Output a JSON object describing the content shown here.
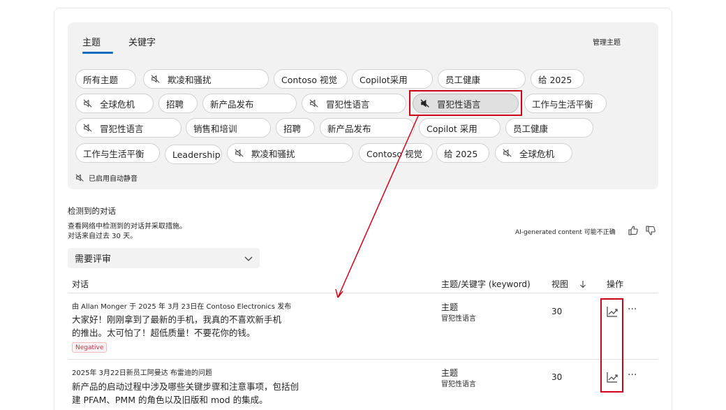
{
  "tabs": [
    {
      "label": "主题"
    },
    {
      "label": "关键字"
    }
  ],
  "manage_topics": "管理主题",
  "chips": {
    "row1": [
      "所有主题",
      "欺凌和骚扰",
      "Contoso 视觉",
      "Copilot采用",
      "员工健康",
      "给 2025"
    ],
    "row2": [
      "全球危机",
      "招聘",
      "新产品发布",
      "冒犯性语言",
      "冒犯性语言",
      "工作与生活平衡"
    ],
    "row3": [
      "冒犯性语言",
      "销售和培训",
      "招聘",
      "新产品发布",
      "Copilot 采用",
      "员工健康"
    ],
    "row4": [
      "工作与生活平衡",
      "Leadership",
      "欺凌和骚扰",
      "Contoso 视觉",
      "给 2025",
      "全球危机"
    ]
  },
  "auto_mute_label": "已启用自动静音",
  "section": {
    "title": "检测到的对话",
    "sub1": "查看网络中检测到的对话并采取措施。",
    "sub2": "对话来自过去 30 天。"
  },
  "ai_note": "AI-generated content 可能不正确",
  "filter": {
    "selected": "需要评审"
  },
  "table": {
    "headers": {
      "conversation": "对话",
      "topic": "主题/关键字 (keyword)",
      "views": "视图",
      "actions": "操作"
    },
    "rows": [
      {
        "meta": "由 Allan Monger 于 2025 年 3月 23日在 Contoso Electronics 发布",
        "line1": "大家好！刚刚拿到了最新的手机，我真的不喜欢新手机",
        "line2": "的推出。太可怕了！超低质量！不要花你的钱。",
        "badge": "Negative",
        "topic_label": "主题",
        "topic_value": "冒犯性语言",
        "views": "30"
      },
      {
        "meta": "2025年 3月22日新员工阿曼达 布雷迪的问题",
        "line1": "新产品的启动过程中涉及哪些关键步骤和注意事项，包括创",
        "line2": "建 PFAM、PMM 的角色以及旧版和 mod 的集成。",
        "topic_label": "主题",
        "topic_value": "冒犯性语言",
        "views": "30"
      }
    ]
  },
  "colors": {
    "accent": "#0f6cbd",
    "annotation_red": "#d0021b",
    "panel_bg": "#f2f2f2",
    "negative": "#c4314b"
  },
  "icons": [
    "mute-icon",
    "chevron-down-icon",
    "thumbs-up-icon",
    "thumbs-down-icon",
    "sort-down-icon",
    "trend-icon",
    "more-icon"
  ]
}
